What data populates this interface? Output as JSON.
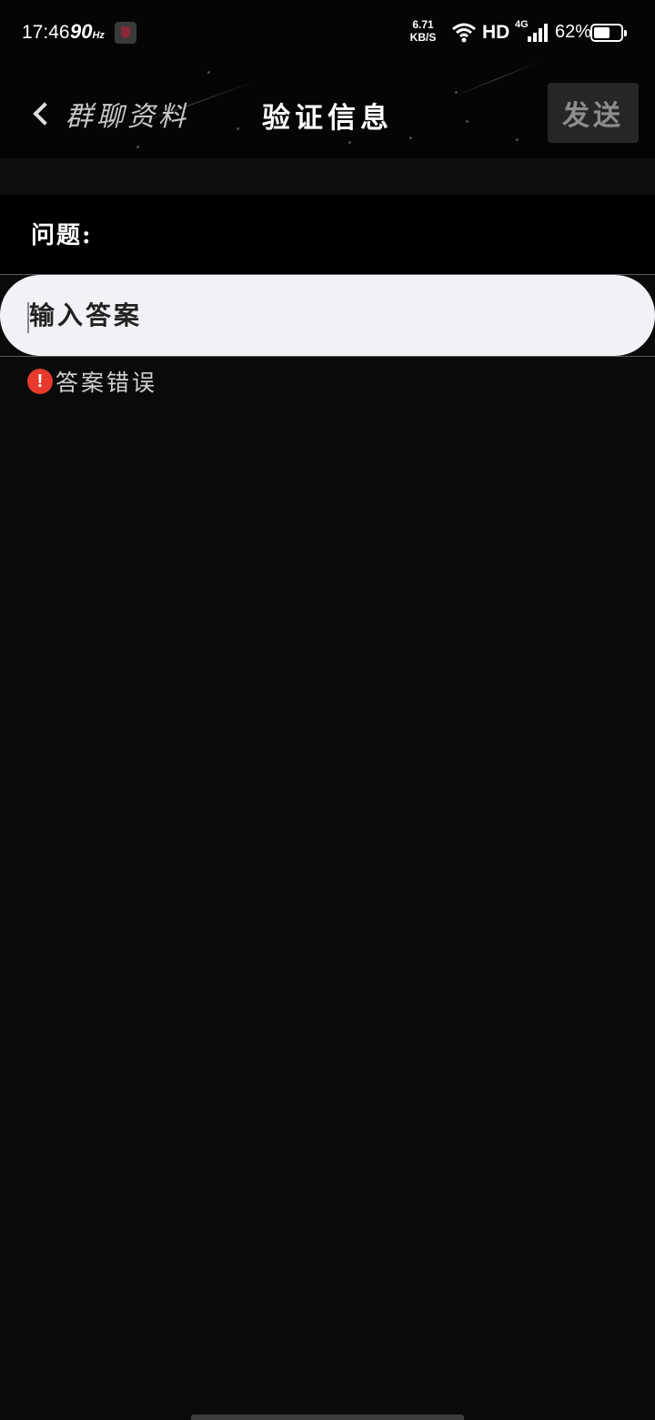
{
  "status_bar": {
    "time": "17:46",
    "refresh_rate": "90",
    "refresh_unit": "Hz",
    "net_speed_value": "6.71",
    "net_speed_unit": "KB/S",
    "hd_label": "HD",
    "network_type": "4G",
    "battery_percent": "62%",
    "battery_level": 0.62
  },
  "nav": {
    "back_label": "群聊资料",
    "title": "验证信息",
    "send_label": "发送"
  },
  "form": {
    "question_label": "问题:",
    "answer_placeholder": "输入答案",
    "answer_value": "",
    "error_icon": "!",
    "error_text": "答案错误"
  },
  "colors": {
    "background": "#0a0a0a",
    "input_background": "#f2f2f6",
    "error_red": "#e53a2c",
    "send_button_bg": "#262626"
  }
}
